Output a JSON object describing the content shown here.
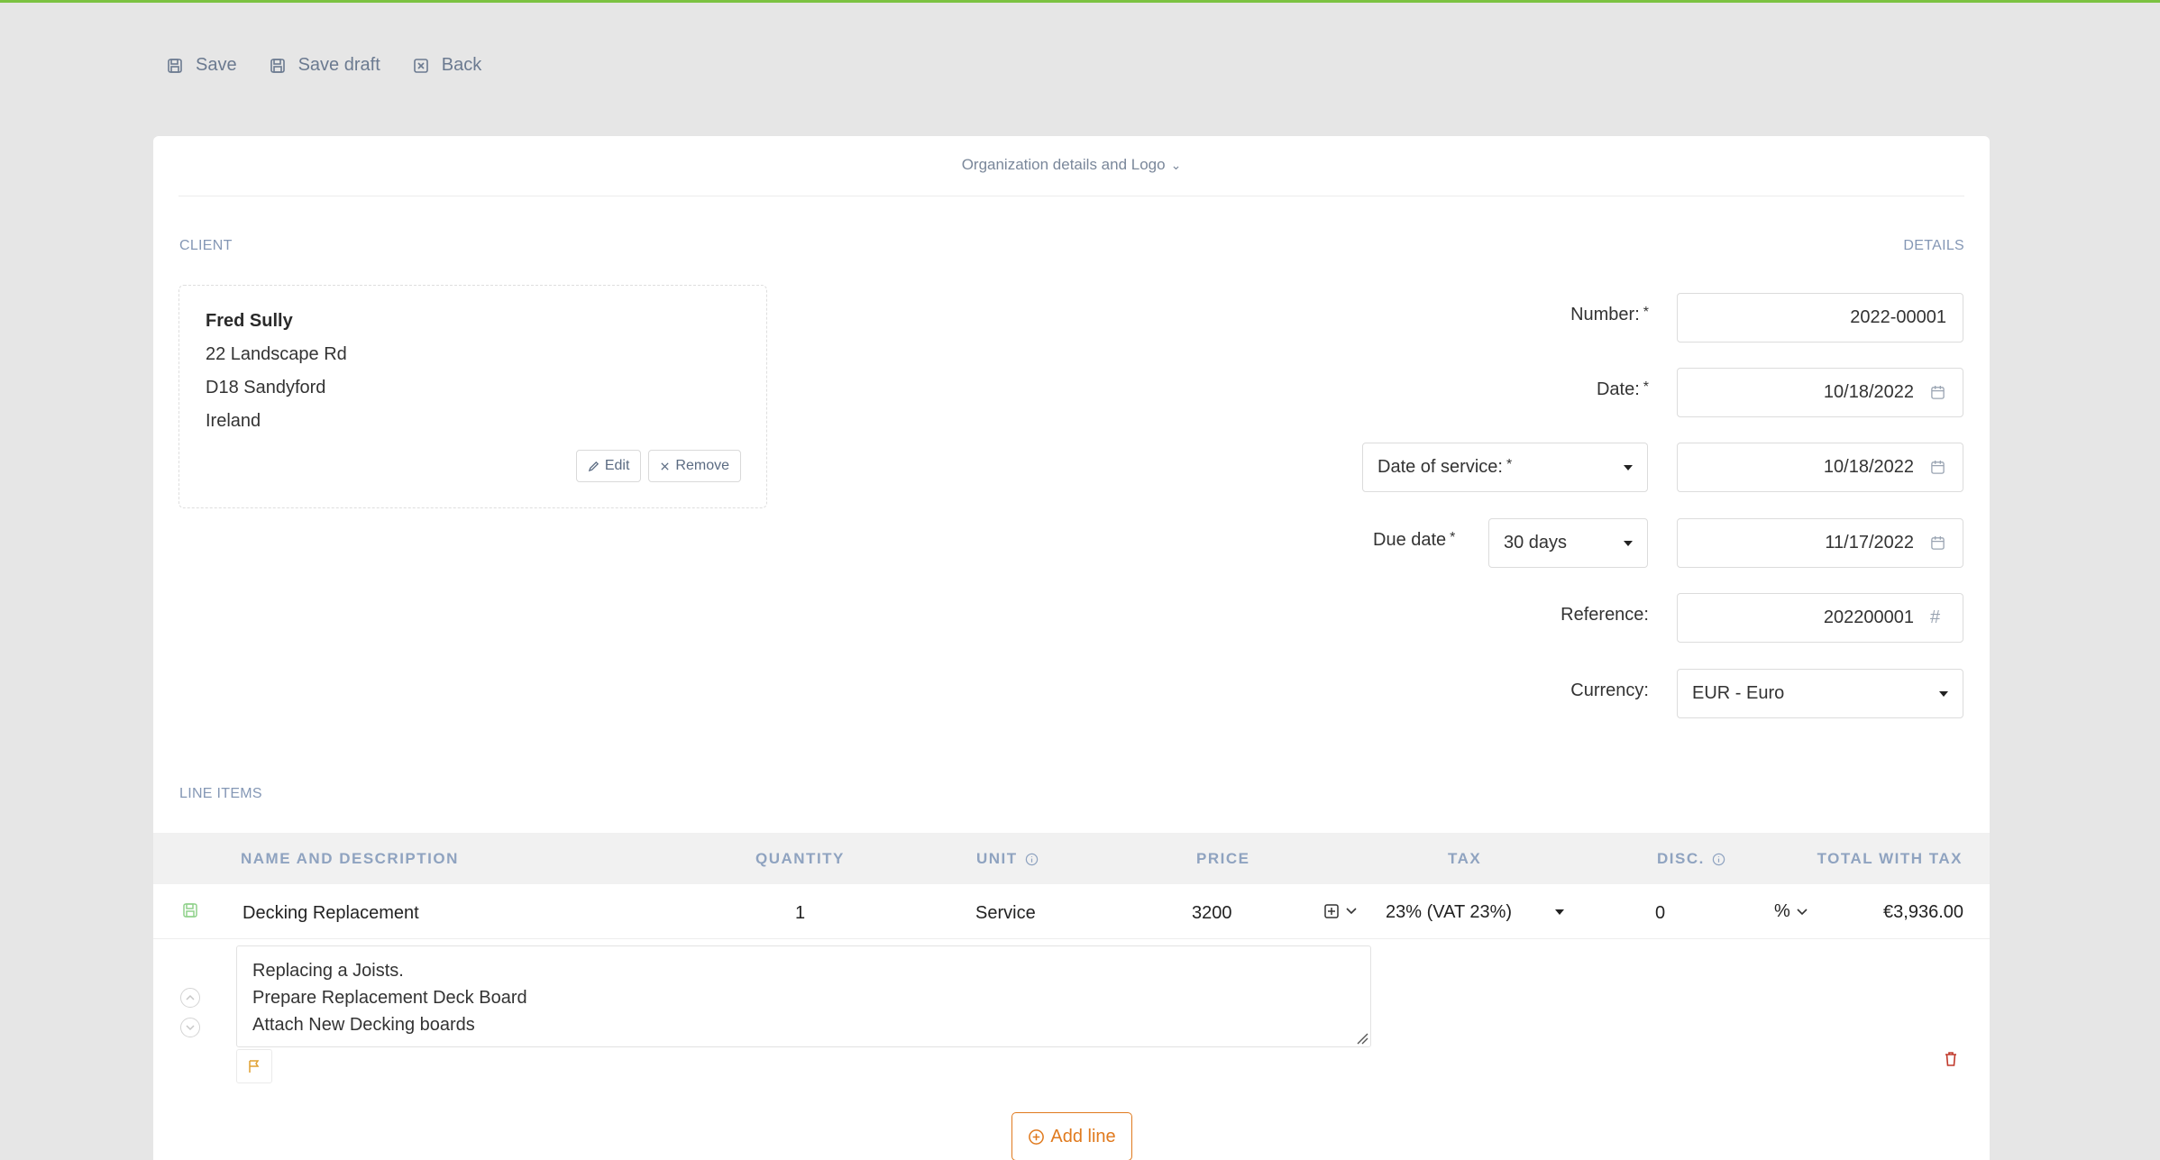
{
  "toolbar": {
    "save": "Save",
    "save_draft": "Save draft",
    "back": "Back"
  },
  "org_toggle": "Organization details and Logo",
  "sections": {
    "client": "CLIENT",
    "details": "DETAILS",
    "line_items": "LINE ITEMS"
  },
  "client": {
    "name": "Fred Sully",
    "address1": "22 Landscape Rd",
    "address2": "D18 Sandyford",
    "country": "Ireland",
    "edit": "Edit",
    "remove": "Remove"
  },
  "details": {
    "number_label": "Number:",
    "number": "2022-00001",
    "date_label": "Date:",
    "date": "10/18/2022",
    "service_select": "Date of service:",
    "service_date": "10/18/2022",
    "due_label": "Due date",
    "due_terms": "30 days",
    "due_date": "11/17/2022",
    "reference_label": "Reference:",
    "reference": "202200001",
    "currency_label": "Currency:",
    "currency": "EUR - Euro",
    "required_mark": "*"
  },
  "table": {
    "headers": {
      "name": "NAME AND DESCRIPTION",
      "quantity": "QUANTITY",
      "unit": "UNIT",
      "price": "PRICE",
      "tax": "TAX",
      "disc": "DISC.",
      "total": "TOTAL WITH TAX"
    },
    "rows": [
      {
        "name": "Decking Replacement",
        "quantity": "1",
        "unit": "Service",
        "price": "3200",
        "tax": "23% (VAT 23%)",
        "discount": "0",
        "discount_type": "%",
        "total": "€3,936.00",
        "description": [
          "Replacing a Joists.",
          "Prepare Replacement Deck Board",
          "Attach New Decking boards"
        ]
      }
    ]
  },
  "add_line": "Add line",
  "colors": {
    "accent_green": "#7cc242",
    "accent_orange": "#e07a1e",
    "muted_blue": "#8497b5",
    "delete_red": "#c0392b"
  }
}
